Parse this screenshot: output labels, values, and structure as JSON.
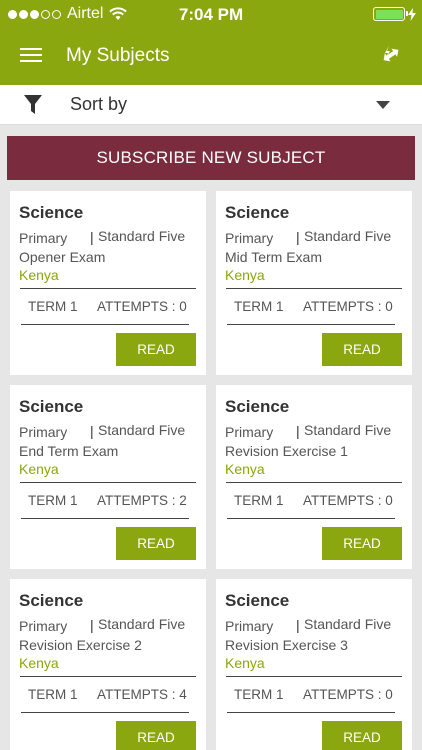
{
  "status_bar": {
    "carrier": "Airtel",
    "time": "7:04 PM",
    "battery_color": "#7ee05a",
    "battery_level": 1.0,
    "signal_bars": 3,
    "signal_total": 5
  },
  "header": {
    "title": "My Subjects",
    "background": "#8aa70f",
    "menu_icon": "hamburger-icon",
    "right_icon": "swap-arrows-icon"
  },
  "sort": {
    "label": "Sort by",
    "filter_icon": "filter-icon",
    "dropdown_icon": "chevron-down-icon"
  },
  "subscribe": {
    "label": "SUBSCRIBE NEW SUBJECT",
    "background": "#7a2b3e"
  },
  "cards": [
    {
      "subject": "Science",
      "level": "Primary",
      "separator": "|",
      "standard": "Standard Five",
      "exam": "Opener Exam",
      "country": "Kenya",
      "term": "TERM 1",
      "attempts": "ATTEMPTS : 0",
      "action": "READ"
    },
    {
      "subject": "Science",
      "level": "Primary",
      "separator": "|",
      "standard": "Standard Five",
      "exam": "Mid Term Exam",
      "country": "Kenya",
      "term": "TERM 1",
      "attempts": "ATTEMPTS : 0",
      "action": "READ"
    },
    {
      "subject": "Science",
      "level": "Primary",
      "separator": "|",
      "standard": "Standard Five",
      "exam": "End Term Exam",
      "country": "Kenya",
      "term": "TERM 1",
      "attempts": "ATTEMPTS : 2",
      "action": "READ"
    },
    {
      "subject": "Science",
      "level": "Primary",
      "separator": "|",
      "standard": "Standard Five",
      "exam": "Revision Exercise 1",
      "country": "Kenya",
      "term": "TERM 1",
      "attempts": "ATTEMPTS : 0",
      "action": "READ"
    },
    {
      "subject": "Science",
      "level": "Primary",
      "separator": "|",
      "standard": "Standard Five",
      "exam": "Revision Exercise 2",
      "country": "Kenya",
      "term": "TERM 1",
      "attempts": "ATTEMPTS : 4",
      "action": "READ"
    },
    {
      "subject": "Science",
      "level": "Primary",
      "separator": "|",
      "standard": "Standard Five",
      "exam": "Revision Exercise 3",
      "country": "Kenya",
      "term": "TERM 1",
      "attempts": "ATTEMPTS : 0",
      "action": "READ"
    }
  ],
  "accent_color": "#8aa70f"
}
